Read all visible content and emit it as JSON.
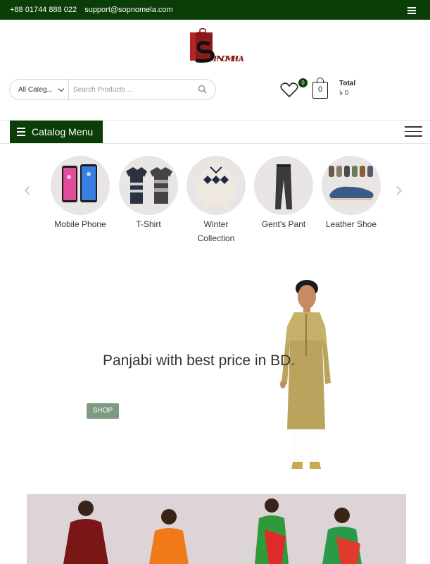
{
  "topbar": {
    "phone": "+88 01744 888 022",
    "email": "support@sopnomela.com",
    "menu_icon": "hamburger-icon"
  },
  "brand": {
    "logo_text": "SOPNOMELA",
    "logo_colors": [
      "#8b1a1a",
      "#111111"
    ]
  },
  "search": {
    "category_selected": "All Categ...",
    "placeholder": "Search Products ...",
    "icon": "search-icon"
  },
  "header": {
    "wishlist_count": "0",
    "cart_count": "0",
    "total_label": "Total",
    "total_value": "৳ 0"
  },
  "nav": {
    "catalog_label": "Catalog Menu"
  },
  "categories": {
    "items": [
      {
        "label": "Mobile Phone"
      },
      {
        "label": "T-Shirt"
      },
      {
        "label": "Winter Collection"
      },
      {
        "label": "Gent's Pant"
      },
      {
        "label": "Leather Shoe"
      }
    ],
    "prev_icon": "chevron-left-icon",
    "next_icon": "chevron-right-icon"
  },
  "hero": {
    "title": "Panjabi with best price in BD.",
    "button_label": "SHOP"
  },
  "colors": {
    "primary": "#0b3d06",
    "shop_button": "#7e9a80",
    "banner_bg": "#dcd4d7"
  }
}
